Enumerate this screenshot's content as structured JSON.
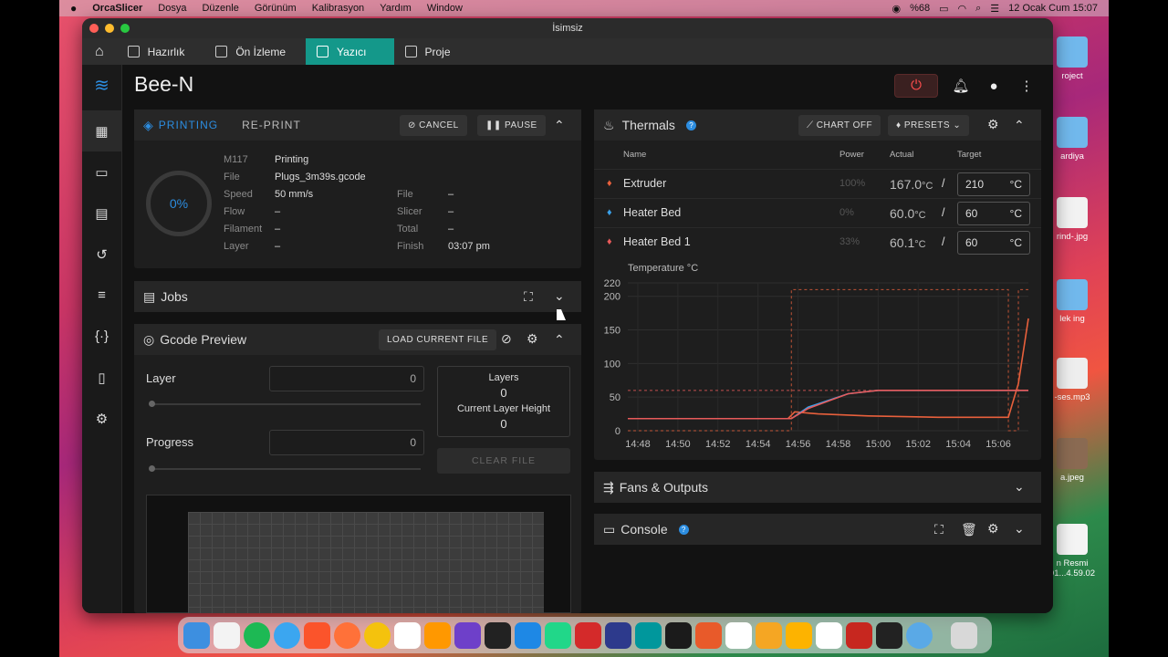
{
  "menubar": {
    "apple": "",
    "app": "OrcaSlicer",
    "items": [
      "Dosya",
      "Düzenle",
      "Görünüm",
      "Kalibrasyon",
      "Yardım",
      "Window"
    ],
    "battery": "%68",
    "clock": "12 Ocak Cum  15:07"
  },
  "desktop": {
    "items": [
      "roject",
      "ardiya",
      "rind-.jpg",
      "lek ing",
      "-ses.mp3",
      "a.jpeg",
      "n Resmi",
      "01...4.59.02"
    ]
  },
  "window": {
    "title": "İsimsiz",
    "tabs": [
      {
        "label": "Hazırlık",
        "icon": "cube-icon"
      },
      {
        "label": "Ön İzleme",
        "icon": "layers-icon"
      },
      {
        "label": "Yazıcı",
        "icon": "printer-icon"
      },
      {
        "label": "Proje",
        "icon": "document-icon"
      }
    ]
  },
  "printer": {
    "name": "Bee-N",
    "status": {
      "state": "PRINTING",
      "reprint": "RE-PRINT",
      "cancel": "CANCEL",
      "pause": "PAUSE",
      "progress": "0%",
      "progress_value": 0,
      "m117_label": "M117",
      "m117_value": "Printing",
      "file_label": "File",
      "file_value": "Plugs_3m39s.gcode",
      "speed_label": "Speed",
      "speed_value": "50 mm/s",
      "flow_label": "Flow",
      "flow_value": "–",
      "filament_label": "Filament",
      "filament_value": "–",
      "layer_label": "Layer",
      "layer_value": "–",
      "file2_label": "File",
      "file2_value": "–",
      "slicer_label": "Slicer",
      "slicer_value": "–",
      "total_label": "Total",
      "total_value": "–",
      "finish_label": "Finish",
      "finish_value": "03:07 pm"
    },
    "jobs": {
      "title": "Jobs"
    },
    "gcode": {
      "title": "Gcode Preview",
      "load": "LOAD CURRENT FILE",
      "layer_label": "Layer",
      "layer_value": "0",
      "progress_label": "Progress",
      "progress_value": "0",
      "layers_label": "Layers",
      "layers_value": "0",
      "clh_label": "Current Layer Height",
      "clh_value": "0",
      "clear": "CLEAR FILE"
    },
    "thermals": {
      "title": "Thermals",
      "chart_btn": "CHART OFF",
      "presets_btn": "PRESETS",
      "cols": {
        "name": "Name",
        "power": "Power",
        "actual": "Actual",
        "target": "Target"
      },
      "rows": [
        {
          "name": "Extruder",
          "power": "100",
          "pct": "%",
          "actual": "167.0",
          "unit": "°C",
          "sep": "/",
          "target": "210",
          "tunit": "°C",
          "color": "#e8603c"
        },
        {
          "name": "Heater Bed",
          "power": "0",
          "pct": "%",
          "actual": "60.0",
          "unit": "°C",
          "sep": "/",
          "target": "60",
          "tunit": "°C",
          "color": "#3aa0e8"
        },
        {
          "name": "Heater Bed 1",
          "power": "33",
          "pct": "%",
          "actual": "60.1",
          "unit": "°C",
          "sep": "/",
          "target": "60",
          "tunit": "°C",
          "color": "#e85a5a"
        }
      ]
    },
    "fans": {
      "title": "Fans & Outputs"
    },
    "console": {
      "title": "Console"
    }
  },
  "chart_data": {
    "type": "line",
    "title": "",
    "ylabel": "Temperature °C",
    "xlabel": "",
    "x_ticks": [
      "14:48",
      "14:50",
      "14:52",
      "14:54",
      "14:56",
      "14:58",
      "15:00",
      "15:02",
      "15:04",
      "15:06"
    ],
    "y_ticks": [
      0,
      50,
      100,
      150,
      200,
      220
    ],
    "ylim": [
      0,
      220
    ],
    "xlim": [
      "14:47:30",
      "15:07:30"
    ],
    "series": [
      {
        "color": "#e8603c",
        "x": [
          "14:47:30",
          "14:55:30",
          "14:55:50",
          "14:57:00",
          "14:59:30",
          "15:03:00",
          "15:06:30",
          "15:07:00",
          "15:07:30"
        ],
        "y": [
          18,
          18,
          28,
          25,
          22,
          20,
          20,
          70,
          167
        ]
      },
      {
        "color": "#3aa0e8",
        "x": [
          "14:47:30",
          "14:55:40",
          "14:56:30",
          "14:58:30",
          "15:00:00",
          "15:07:30"
        ],
        "y": [
          18,
          18,
          35,
          55,
          60,
          60
        ]
      },
      {
        "color": "#e85a5a",
        "x": [
          "14:47:30",
          "14:55:40",
          "14:56:30",
          "14:58:30",
          "15:00:00",
          "15:07:30"
        ],
        "y": [
          18,
          18,
          33,
          55,
          60,
          60
        ]
      },
      {
        "color": "#e8603c",
        "dashed": true,
        "x": [
          "14:47:30",
          "14:55:40",
          "14:55:40",
          "15:06:30",
          "15:06:30",
          "15:07:00",
          "15:07:00",
          "15:07:30"
        ],
        "y": [
          0,
          0,
          210,
          210,
          0,
          0,
          210,
          210
        ]
      },
      {
        "color": "#e85a5a",
        "dashed": true,
        "x": [
          "14:47:30",
          "15:07:30"
        ],
        "y": [
          60,
          60
        ]
      }
    ]
  }
}
